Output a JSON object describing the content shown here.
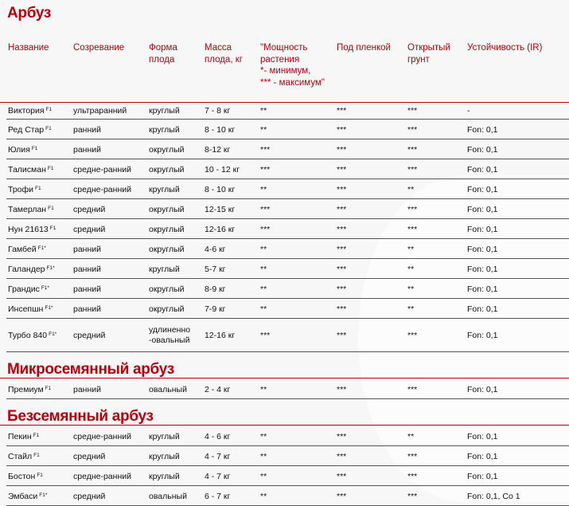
{
  "title": "Арбуз",
  "headers": [
    "Название",
    "Созревание",
    "Форма плода",
    "Масса плода, кг",
    "\"Мощность растения *- минимум, *** - максимум\"",
    "Под пленкой",
    "Открытый грунт",
    "Устойчивость (IR)"
  ],
  "header_lines": {
    "h2": [
      "Форма",
      "плода"
    ],
    "h3": [
      "Масса",
      "плода, кг"
    ],
    "h4": [
      "\"Мощность",
      "растения",
      "*- минимум,",
      "*** - максимум\""
    ],
    "h6": [
      "Открытый",
      "грунт"
    ]
  },
  "sections": [
    {
      "title": "Арбуз",
      "rows": [
        [
          "Виктория",
          "F1",
          "ультраранний",
          "круглый",
          "7 - 8 кг",
          "**",
          "***",
          "***",
          "-"
        ],
        [
          "Ред Стар",
          "F1",
          "ранний",
          "круглый",
          "8 - 10 кг",
          "**",
          "***",
          "***",
          "Fon: 0,1"
        ],
        [
          "Юлия",
          "F1",
          "ранний",
          "округлый",
          "8-12 кг",
          "***",
          "***",
          "***",
          "Fon: 0,1"
        ],
        [
          "Талисман",
          "F1",
          "средне-ранний",
          "округлый",
          "10 - 12 кг",
          "***",
          "***",
          "***",
          "Fon: 0,1"
        ],
        [
          "Трофи",
          "F1",
          "средне-ранний",
          "круглый",
          "8 - 10 кг",
          "**",
          "***",
          "**",
          "Fon: 0,1"
        ],
        [
          "Тамерлан",
          "F1",
          "средний",
          "округлый",
          "12-15 кг",
          "***",
          "***",
          "***",
          "Fon: 0,1"
        ],
        [
          "Нун 21613",
          "F1",
          "средний",
          "округлый",
          "12-16 кг",
          "***",
          "***",
          "***",
          "Fon: 0,1"
        ],
        [
          "Гамбей",
          "F1*",
          "ранний",
          "округлый",
          "4-6 кг",
          "**",
          "***",
          "**",
          "Fon: 0,1"
        ],
        [
          "Галандер",
          "F1*",
          "ранний",
          "круглый",
          "5-7 кг",
          "**",
          "***",
          "**",
          "Fon: 0,1"
        ],
        [
          "Грандис",
          "F1*",
          "ранний",
          "округлый",
          "8-9 кг",
          "**",
          "***",
          "**",
          "Fon: 0,1"
        ],
        [
          "Инсепшн",
          "F1*",
          "ранний",
          "округлый",
          "7-9 кг",
          "**",
          "***",
          "**",
          "Fon: 0,1"
        ],
        [
          "Турбо 840",
          "F1*",
          "средний",
          "удлиненно -овальный",
          "12-16 кг",
          "***",
          "***",
          "***",
          "Fon: 0,1"
        ]
      ]
    },
    {
      "title": "Микросемянный арбуз",
      "rows": [
        [
          "Премиум",
          "F1",
          "ранний",
          "овальный",
          "2 - 4 кг",
          "**",
          "***",
          "***",
          "Fon: 0,1"
        ]
      ]
    },
    {
      "title": "Безсемянный арбуз",
      "rows": [
        [
          "Пекин",
          "F1",
          "средне-ранний",
          "круглый",
          "4 - 6 кг",
          "**",
          "***",
          "**",
          "Fon: 0,1"
        ],
        [
          "Стайл",
          "F1",
          "средний",
          "круглый",
          "4 - 7 кг",
          "**",
          "***",
          "***",
          "Fon: 0,1"
        ],
        [
          "Бостон",
          "F1",
          "средне-ранний",
          "круглый",
          "4 - 7 кг",
          "**",
          "***",
          "***",
          "Fon: 0,1"
        ],
        [
          "Эмбаси",
          "F1*",
          "средний",
          "овальный",
          "6 - 7 кг",
          "**",
          "***",
          "***",
          "Fon: 0,1, Co 1"
        ]
      ]
    }
  ],
  "colors": {
    "accent": "#b3000c",
    "row_line": "#555555"
  }
}
